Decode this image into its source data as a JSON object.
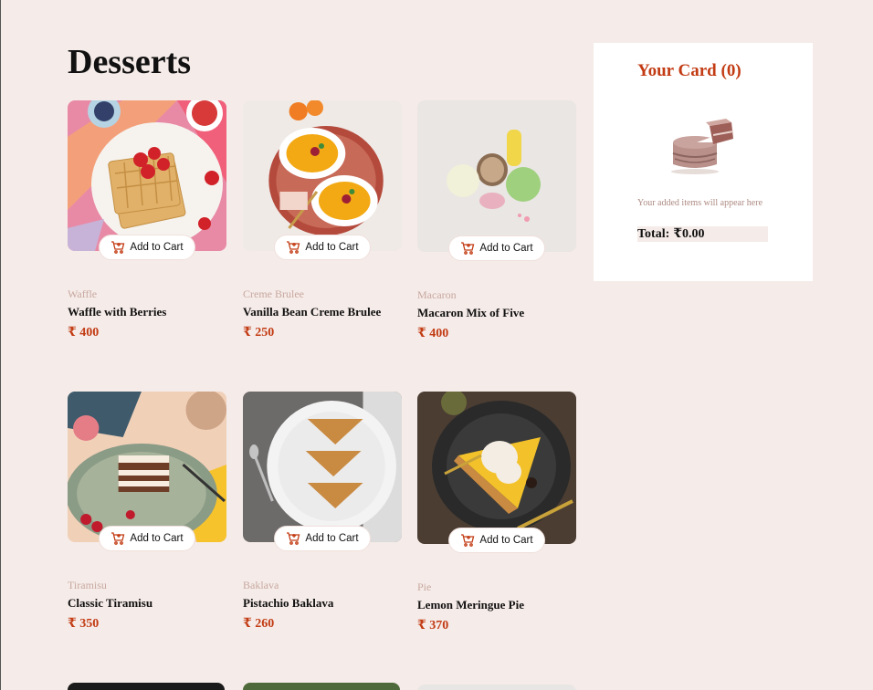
{
  "page": {
    "title": "Desserts"
  },
  "add_to_cart_label": "Add to Cart",
  "products": [
    {
      "category": "Waffle",
      "name": "Waffle with Berries",
      "price": "₹ 400"
    },
    {
      "category": "Creme Brulee",
      "name": "Vanilla Bean Creme Brulee",
      "price": "₹ 250"
    },
    {
      "category": "Macaron",
      "name": "Macaron Mix of Five",
      "price": "₹ 400"
    },
    {
      "category": "Tiramisu",
      "name": "Classic Tiramisu",
      "price": "₹ 350"
    },
    {
      "category": "Baklava",
      "name": "Pistachio Baklava",
      "price": "₹ 260"
    },
    {
      "category": "Pie",
      "name": "Lemon Meringue Pie",
      "price": "₹ 370"
    }
  ],
  "cart": {
    "title": "Your Card (0)",
    "empty_message": "Your added items will appear here",
    "total_label": "Total:",
    "total_value": "₹0.00"
  },
  "colors": {
    "background": "#f5ebe8",
    "accent": "#c23b13",
    "muted_text": "#c8a8a0"
  },
  "icons": {
    "add_to_cart": "cart-plus-icon",
    "empty_cart": "cake-slice-icon"
  }
}
